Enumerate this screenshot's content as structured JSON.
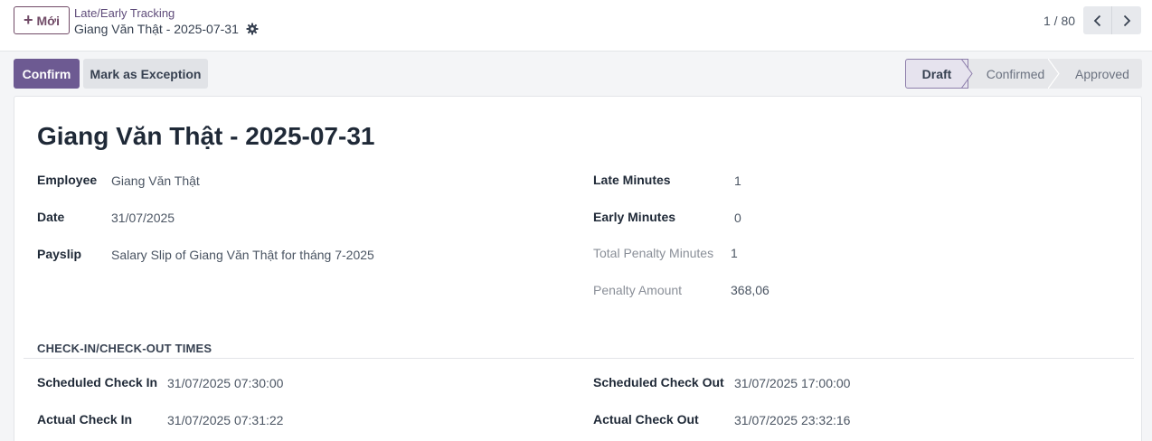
{
  "control_panel": {
    "new_button_label": "Mới",
    "breadcrumb_parent": "Late/Early Tracking",
    "breadcrumb_current": "Giang Văn Thật - 2025-07-31",
    "pager_text": "1 / 80"
  },
  "actions": {
    "confirm_label": "Confirm",
    "exception_label": "Mark as Exception"
  },
  "statusbar": {
    "stages": [
      "Draft",
      "Confirmed",
      "Approved"
    ],
    "active": "Draft"
  },
  "form": {
    "title": "Giang Văn Thật - 2025-07-31",
    "employee_label": "Employee",
    "employee_value": "Giang Văn Thật",
    "date_label": "Date",
    "date_value": "31/07/2025",
    "payslip_label": "Payslip",
    "payslip_value": "Salary Slip of Giang Văn Thật for tháng 7-2025",
    "late_minutes_label": "Late Minutes",
    "late_minutes_value": "1",
    "early_minutes_label": "Early Minutes",
    "early_minutes_value": "0",
    "total_penalty_label": "Total Penalty Minutes",
    "total_penalty_value": "1",
    "penalty_amount_label": "Penalty Amount",
    "penalty_amount_value": "368,06",
    "section_title": "CHECK-IN/CHECK-OUT TIMES",
    "scheduled_in_label": "Scheduled Check In",
    "scheduled_in_value": "31/07/2025 07:30:00",
    "actual_in_label": "Actual Check In",
    "actual_in_value": "31/07/2025 07:31:22",
    "scheduled_out_label": "Scheduled Check Out",
    "scheduled_out_value": "31/07/2025 17:00:00",
    "actual_out_label": "Actual Check Out",
    "actual_out_value": "31/07/2025 23:32:16"
  },
  "colors": {
    "brand": "#714b67",
    "primary_button": "#6d5a92",
    "active_stage": "#e6e3ee"
  }
}
